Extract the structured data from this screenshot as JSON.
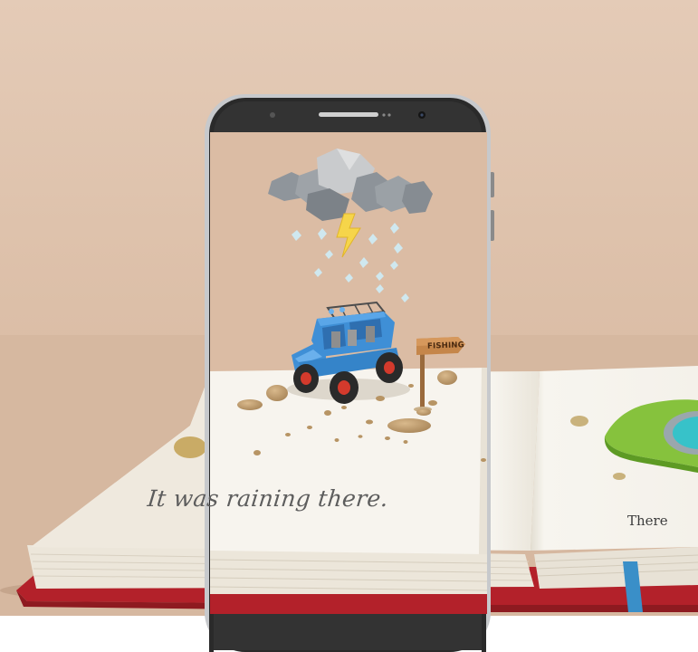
{
  "book": {
    "page_left_text": "It was raining there.",
    "page_right_text": "There",
    "sign_text": "FISHING"
  },
  "colors": {
    "background": "#dfc3ad",
    "phone_frame": "#2b2b2b",
    "jeep": "#3f8fd6",
    "book_cover": "#c0262b",
    "bookmark": "#3a8fc8"
  }
}
